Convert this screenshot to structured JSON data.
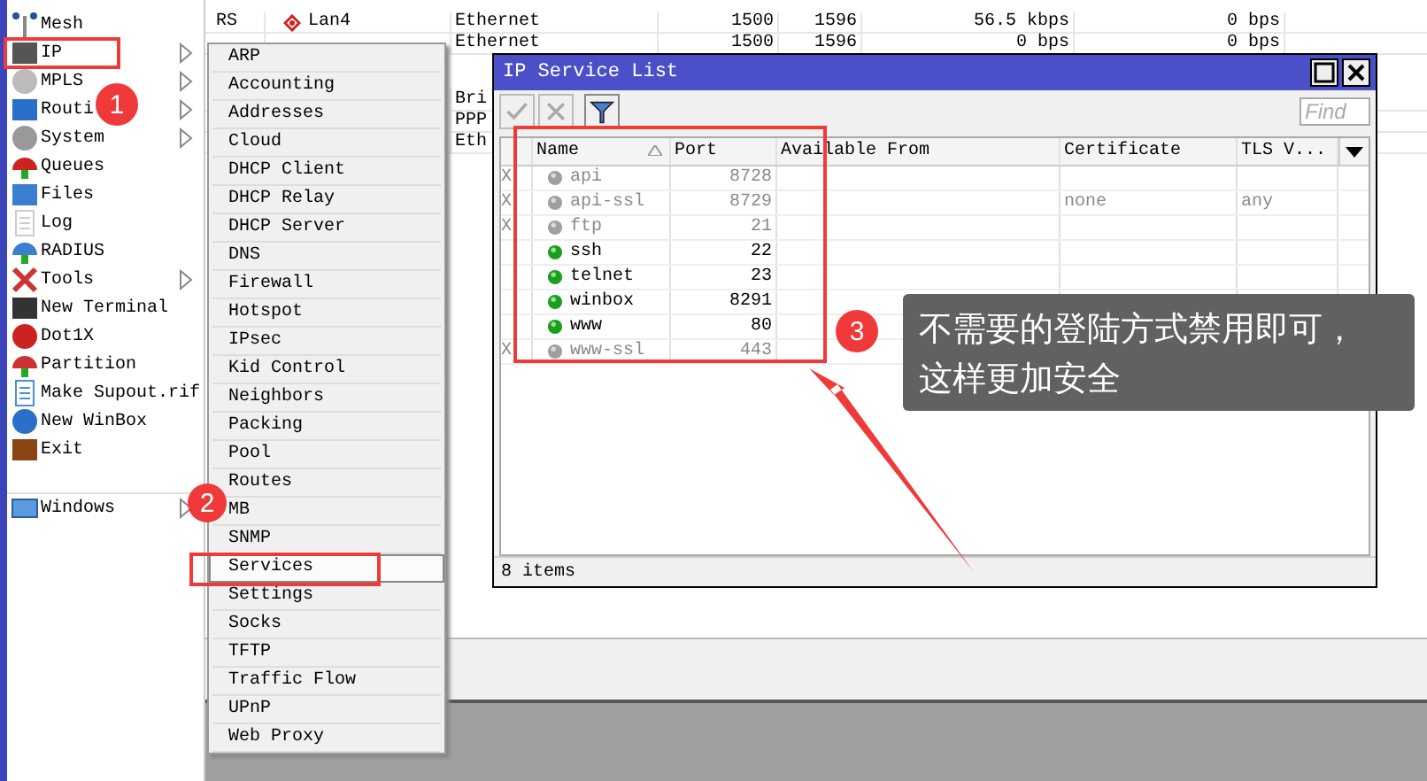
{
  "interfaces": {
    "rows": [
      {
        "flags": "RS",
        "name": "Lan4",
        "type": "Ethernet",
        "mtu": "1500",
        "l2mtu": "1596",
        "tx": "56.5 kbps",
        "rx": "0 bps"
      },
      {
        "type": "Ethernet",
        "mtu": "1500",
        "l2mtu": "1596",
        "tx": "0 bps",
        "rx": "0 bps"
      },
      {
        "type": "Bri"
      },
      {
        "type": "PPP"
      },
      {
        "type": "Eth"
      }
    ]
  },
  "sidebar": {
    "items": [
      {
        "label": "Mesh",
        "submenu": false
      },
      {
        "label": "IP",
        "submenu": true
      },
      {
        "label": "MPLS",
        "submenu": true
      },
      {
        "label": "Routi",
        "submenu": true
      },
      {
        "label": "System",
        "submenu": true
      },
      {
        "label": "Queues",
        "submenu": false
      },
      {
        "label": "Files",
        "submenu": false
      },
      {
        "label": "Log",
        "submenu": false
      },
      {
        "label": "RADIUS",
        "submenu": false
      },
      {
        "label": "Tools",
        "submenu": true
      },
      {
        "label": "New Terminal",
        "submenu": false
      },
      {
        "label": "Dot1X",
        "submenu": false
      },
      {
        "label": "Partition",
        "submenu": false
      },
      {
        "label": "Make Supout.rif",
        "submenu": false
      },
      {
        "label": "New WinBox",
        "submenu": false
      },
      {
        "label": "Exit",
        "submenu": false
      }
    ],
    "bottom_items": [
      {
        "label": "Windows",
        "submenu": true
      }
    ]
  },
  "ip_menu": {
    "items": [
      {
        "label": "ARP",
        "selected": false
      },
      {
        "label": "Accounting",
        "selected": false
      },
      {
        "label": "Addresses",
        "selected": false
      },
      {
        "label": "Cloud",
        "selected": false
      },
      {
        "label": "DHCP Client",
        "selected": false
      },
      {
        "label": "DHCP Relay",
        "selected": false
      },
      {
        "label": "DHCP Server",
        "selected": false
      },
      {
        "label": "DNS",
        "selected": false
      },
      {
        "label": "Firewall",
        "selected": false
      },
      {
        "label": "Hotspot",
        "selected": false
      },
      {
        "label": "IPsec",
        "selected": false
      },
      {
        "label": "Kid Control",
        "selected": false
      },
      {
        "label": "Neighbors",
        "selected": false
      },
      {
        "label": "Packing",
        "selected": false
      },
      {
        "label": "Pool",
        "selected": false
      },
      {
        "label": "Routes",
        "selected": false
      },
      {
        "label": "MB",
        "selected": false
      },
      {
        "label": "SNMP",
        "selected": false
      },
      {
        "label": "Services",
        "selected": true
      },
      {
        "label": "Settings",
        "selected": false
      },
      {
        "label": "Socks",
        "selected": false
      },
      {
        "label": "TFTP",
        "selected": false
      },
      {
        "label": "Traffic Flow",
        "selected": false
      },
      {
        "label": "UPnP",
        "selected": false
      },
      {
        "label": "Web Proxy",
        "selected": false
      }
    ]
  },
  "service_window": {
    "title": "IP Service List",
    "find_placeholder": "Find",
    "columns": [
      "Name",
      "Port",
      "Available From",
      "Certificate",
      "TLS V..."
    ],
    "rows": [
      {
        "flag": "X",
        "name": "api",
        "port": "8728",
        "disabled": true
      },
      {
        "flag": "X",
        "name": "api-ssl",
        "port": "8729",
        "certificate": "none",
        "tls_version": "any",
        "disabled": true
      },
      {
        "flag": "X",
        "name": "ftp",
        "port": "21",
        "disabled": true
      },
      {
        "name": "ssh",
        "port": "22",
        "disabled": false
      },
      {
        "name": "telnet",
        "port": "23",
        "disabled": false
      },
      {
        "name": "winbox",
        "port": "8291",
        "disabled": false
      },
      {
        "name": "www",
        "port": "80",
        "disabled": false
      },
      {
        "flag": "X",
        "name": "www-ssl",
        "port": "443",
        "disabled": true
      }
    ],
    "status": "8 items"
  },
  "annotations": {
    "badges": [
      "1",
      "2",
      "3"
    ],
    "callout": "不需要的登陆方式禁用即可，这样更加安全"
  }
}
